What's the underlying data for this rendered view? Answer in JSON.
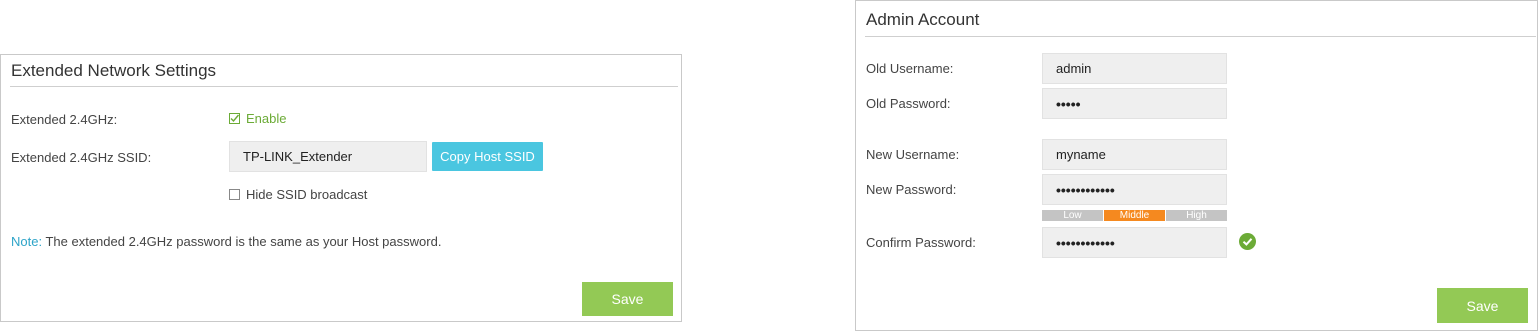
{
  "extended": {
    "title": "Extended Network Settings",
    "row1_label": "Extended 2.4GHz:",
    "enable_label": "Enable",
    "enable_checked": true,
    "row2_label": "Extended 2.4GHz SSID:",
    "ssid_value": "TP-LINK_Extender",
    "copy_button": "Copy Host SSID",
    "hide_label": "Hide SSID broadcast",
    "hide_checked": false,
    "note_label": "Note:",
    "note_text": "The extended 2.4GHz password is the same as your Host password.",
    "save_button": "Save"
  },
  "admin": {
    "title": "Admin Account",
    "old_username_label": "Old Username:",
    "old_username_value": "admin",
    "old_password_label": "Old Password:",
    "old_password_value": "•••••",
    "new_username_label": "New Username:",
    "new_username_value": "myname",
    "new_password_label": "New Password:",
    "new_password_value": "••••••••••••",
    "strength": {
      "low": "Low",
      "middle": "Middle",
      "high": "High",
      "active": "middle"
    },
    "confirm_password_label": "Confirm Password:",
    "confirm_password_value": "••••••••••••",
    "save_button": "Save"
  },
  "colors": {
    "accent_green": "#93c955",
    "check_green": "#6cab37",
    "copy_blue": "#4ac6e0",
    "strength_orange": "#f5891f",
    "strength_gray": "#c4c4c4"
  }
}
